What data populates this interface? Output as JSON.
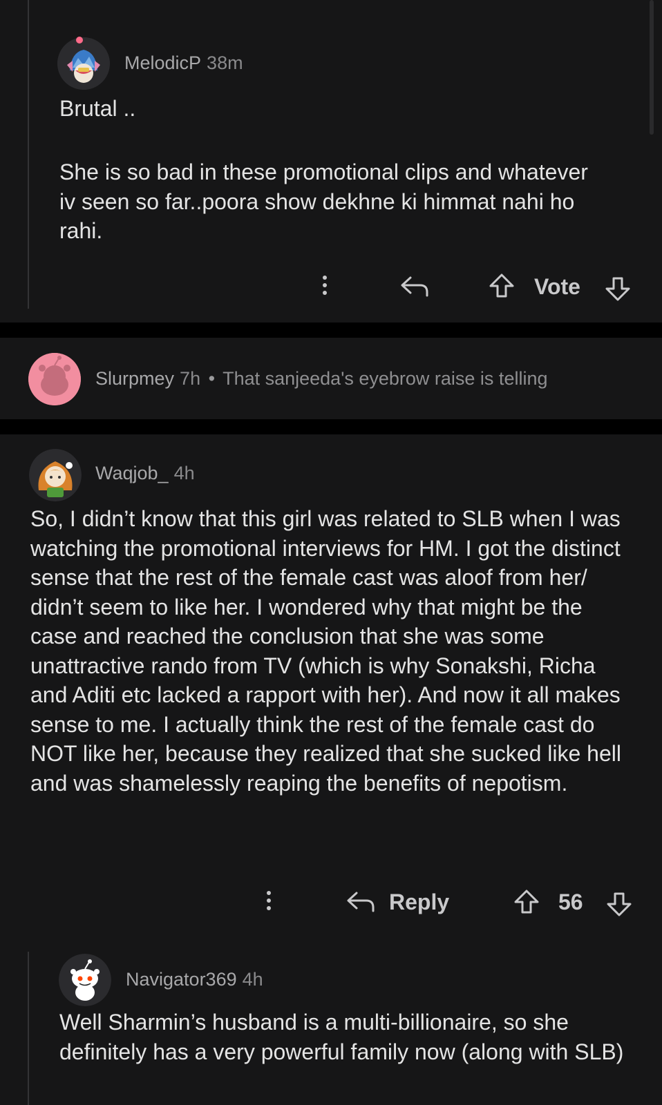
{
  "comments": [
    {
      "user": "MelodicP",
      "time": "38m",
      "paragraphs": [
        "Brutal ..",
        "She is so bad in these promotional clips and whatever iv seen so far..poora show dekhne ki himmat nahi ho rahi."
      ],
      "vote_label": "Vote"
    },
    {
      "user": "Slurpmey",
      "time": "7h",
      "separator": "•",
      "preview": "That sanjeeda's eyebrow raise is telling"
    },
    {
      "user": "Waqjob_",
      "time": "4h",
      "body": "So, I didn’t know that this girl was related to SLB when I was watching the promotional interviews for HM. I got the distinct sense that the rest of the female cast was aloof from her/ didn’t seem to like her. I wondered why that might be the case and reached the conclusion that she was some unattractive rando from TV (which is why Sonakshi, Richa and Aditi etc lacked a rapport with her). And now it all makes sense to me. I actually think the rest of the female cast do NOT like her, because they realized that she sucked like hell and was shamelessly reaping the benefits of nepotism.",
      "reply_label": "Reply",
      "score": "56"
    },
    {
      "user": "Navigator369",
      "time": "4h",
      "body": "Well Sharmin’s husband is a multi-billionaire, so she definitely has a very powerful family now (along with SLB)"
    }
  ],
  "icons": {
    "more": "kebab-icon",
    "reply": "reply-arrow-icon",
    "upvote": "upvote-arrow-icon",
    "downvote": "downvote-arrow-icon"
  },
  "colors": {
    "background": "#161617",
    "separator": "#000000",
    "text": "#e4e4e4",
    "meta": "#9a9a9c"
  }
}
